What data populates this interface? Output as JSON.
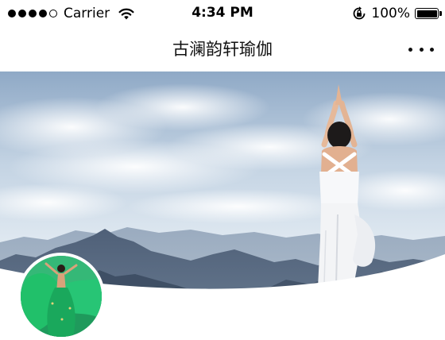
{
  "status_bar": {
    "carrier": "Carrier",
    "time": "4:34 PM",
    "battery_percent": "100%",
    "signal_bars_filled": 4,
    "signal_bars_total": 5,
    "battery_level": 1.0
  },
  "nav": {
    "title": "古澜韵轩瑜伽",
    "more_icon": "more-dots-icon"
  },
  "banner": {
    "image": "yoga-pose-mountain-photo"
  },
  "avatar": {
    "image": "dancer-green-dress-photo"
  },
  "colors": {
    "status_text": "#000000",
    "nav_title": "#111111",
    "background": "#ffffff",
    "sky": "#c9d9e8",
    "mountain": "#5d6f86",
    "avatar_green": "#2bb673"
  }
}
